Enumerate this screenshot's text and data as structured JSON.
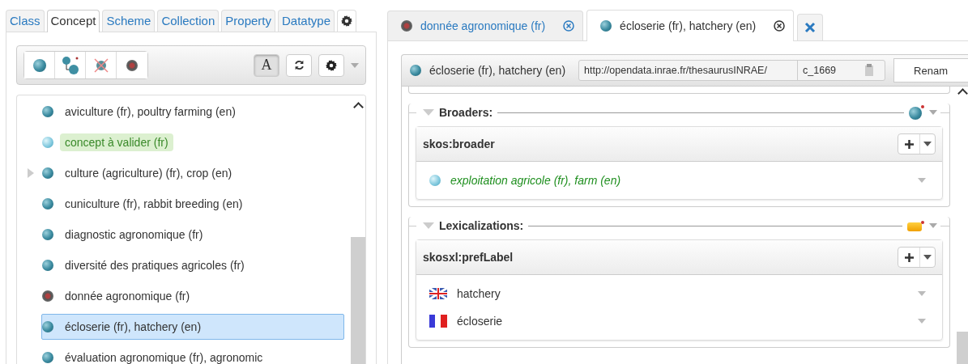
{
  "left_tabs": [
    {
      "label": "Class",
      "selected": false
    },
    {
      "label": "Concept",
      "selected": true
    },
    {
      "label": "Scheme",
      "selected": false
    },
    {
      "label": "Collection",
      "selected": false
    },
    {
      "label": "Property",
      "selected": false
    },
    {
      "label": "Datatype",
      "selected": false
    }
  ],
  "toolbar": {
    "text_toggle": {
      "label": "A",
      "on": true
    }
  },
  "tree": [
    {
      "label": "aviculture (fr), poultry farming (en)",
      "kind": "concept",
      "has_children": false,
      "selected": false
    },
    {
      "label": "concept à valider (fr)",
      "kind": "candidate",
      "has_children": false,
      "selected": false
    },
    {
      "label": "culture (agriculture) (fr), crop (en)",
      "kind": "concept",
      "has_children": true,
      "selected": false
    },
    {
      "label": "cuniculture (fr), rabbit breeding (en)",
      "kind": "concept",
      "has_children": false,
      "selected": false
    },
    {
      "label": "diagnostic agronomique (fr)",
      "kind": "concept",
      "has_children": false,
      "selected": false
    },
    {
      "label": "diversité des pratiques agricoles (fr)",
      "kind": "concept",
      "has_children": false,
      "selected": false
    },
    {
      "label": "donnée agronomique (fr)",
      "kind": "deprecated",
      "has_children": false,
      "selected": false
    },
    {
      "label": "écloserie (fr), hatchery (en)",
      "kind": "concept",
      "has_children": false,
      "selected": true
    },
    {
      "label": "évaluation agronomique (fr), agronomic",
      "kind": "concept",
      "has_children": false,
      "selected": false
    }
  ],
  "right_tabs": [
    {
      "label": "donnée agronomique (fr)",
      "kind": "deprecated",
      "selected": false
    },
    {
      "label": "écloserie (fr), hatchery (en)",
      "kind": "concept",
      "selected": true
    }
  ],
  "resource": {
    "title": "écloserie (fr), hatchery (en)",
    "kind": "concept",
    "namespace": "http://opendata.inrae.fr/thesaurusINRAE/",
    "local_name": "c_1669",
    "rename_button": "Renam"
  },
  "sections": [
    {
      "title": "Broaders:",
      "kind": "broaders",
      "property": "skos:broader",
      "values": [
        {
          "label": "exploitation agricole (fr), farm (en)",
          "kind": "candidate"
        }
      ]
    },
    {
      "title": "Lexicalizations:",
      "kind": "lexicalizations",
      "property": "skosxl:prefLabel",
      "values": [
        {
          "label": "hatchery",
          "kind": "en"
        },
        {
          "label": "écloserie",
          "kind": "fr"
        }
      ]
    }
  ]
}
